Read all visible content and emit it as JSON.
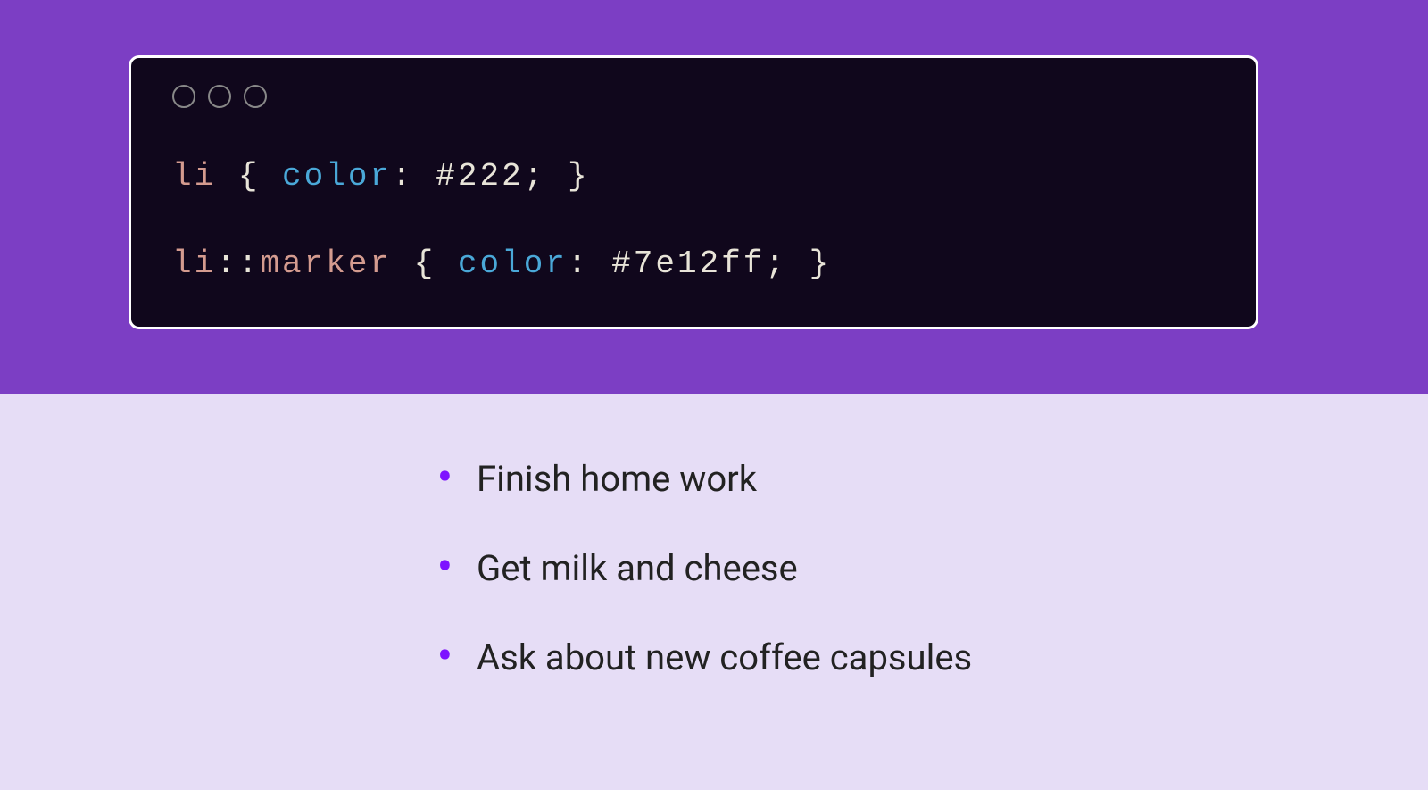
{
  "code": {
    "line1": {
      "selector": "li",
      "space1": " ",
      "brace_open": "{",
      "space2": " ",
      "property": "color",
      "colon": ":",
      "space3": " ",
      "value": "#222",
      "semicolon": ";",
      "space4": " ",
      "brace_close": "}"
    },
    "line2": {
      "selector": "li",
      "pseudo_colons": "::",
      "pseudo": "marker",
      "space1": " ",
      "brace_open": "{",
      "space2": " ",
      "property": "color",
      "colon": ":",
      "space3": " ",
      "value": "#7e12ff",
      "semicolon": ";",
      "space4": " ",
      "brace_close": "}"
    }
  },
  "list": {
    "items": [
      "Finish home work",
      "Get milk and cheese",
      "Ask about new coffee capsules"
    ]
  },
  "colors": {
    "background_top": "#7c3ec4",
    "background_bottom": "#e6ddf6",
    "code_bg": "#10071c",
    "list_text": "#222",
    "list_marker": "#7e12ff"
  }
}
